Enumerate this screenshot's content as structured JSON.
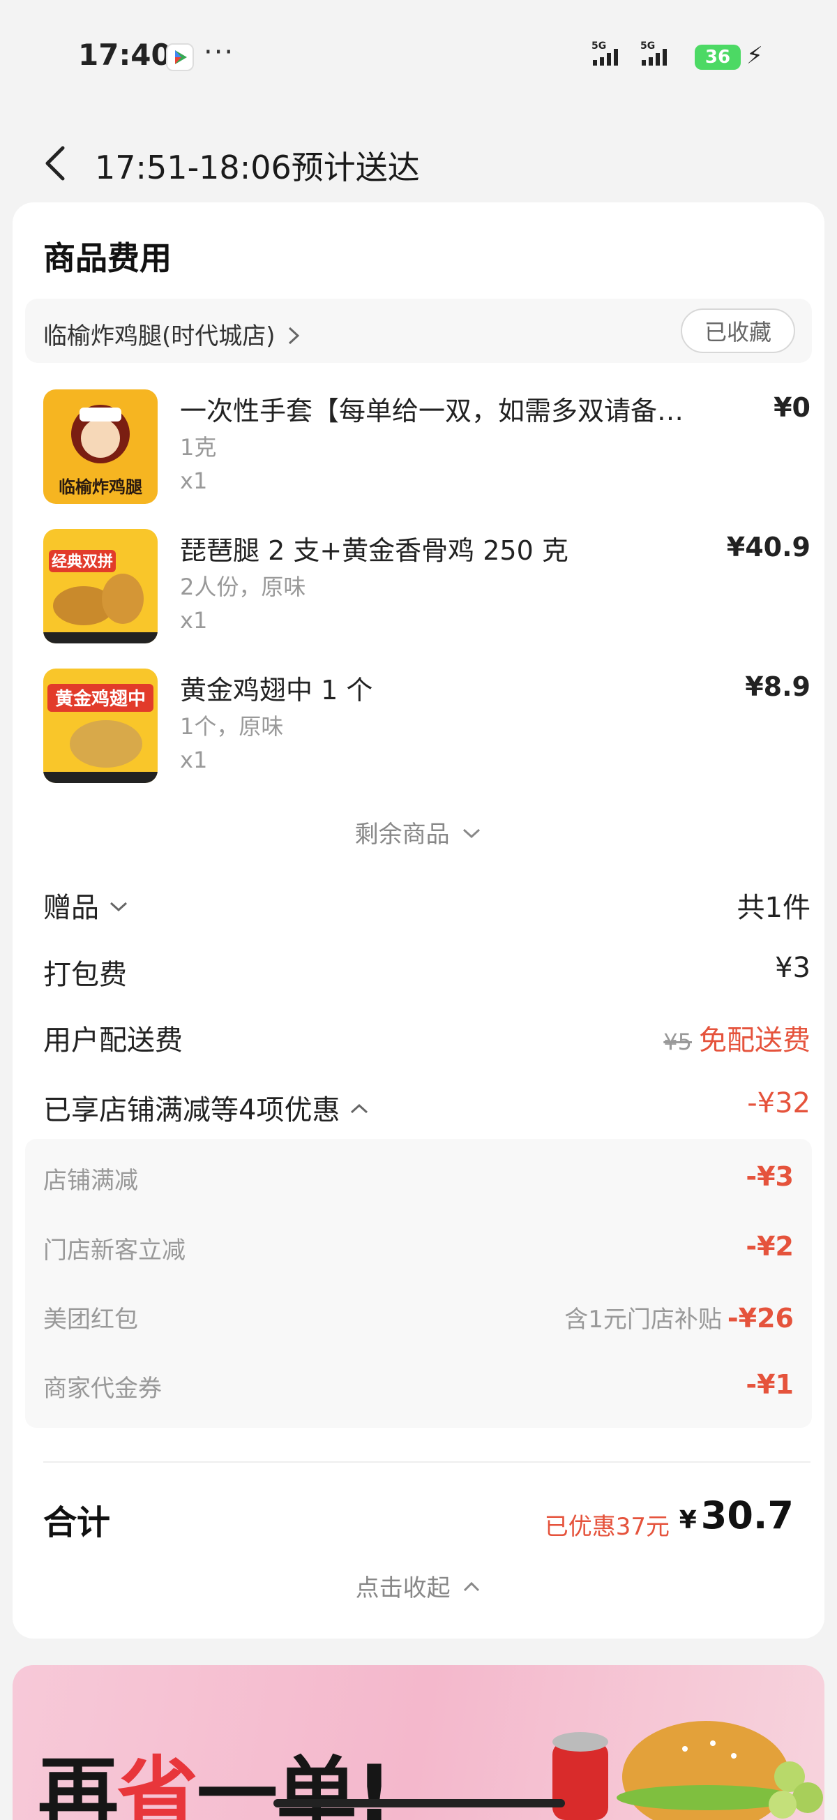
{
  "status": {
    "time": "17:40",
    "battery": "36",
    "dots": "···",
    "net1": "5G",
    "net2": "5G"
  },
  "header": {
    "title": "17:51-18:06预计送达"
  },
  "card": {
    "title": "商品费用",
    "store": {
      "name": "临榆炸鸡腿(时代城店)",
      "fav_label": "已收藏"
    },
    "items": [
      {
        "name": "一次性手套【每单给一双，如需多双请备…",
        "spec": "1克",
        "qty": "x1",
        "price": "¥0",
        "thumb_text": "临榆炸鸡腿"
      },
      {
        "name": "琵琶腿 2 支+黄金香骨鸡 250 克",
        "spec": "2人份，原味",
        "qty": "x1",
        "price": "¥40.9",
        "thumb_text": "经典双拼"
      },
      {
        "name": "黄金鸡翅中 1 个",
        "spec": "1个，原味",
        "qty": "x1",
        "price": "¥8.9",
        "thumb_text": "黄金鸡翅中"
      }
    ],
    "more_label": "剩余商品",
    "gift": {
      "label": "赠品",
      "value": "共1件"
    },
    "packing": {
      "label": "打包费",
      "value": "¥3"
    },
    "delivery": {
      "label": "用户配送费",
      "original": "¥5",
      "value": "免配送费"
    },
    "discount": {
      "label": "已享店铺满减等4项优惠",
      "value": "-¥32",
      "items": [
        {
          "label": "店铺满减",
          "note": "",
          "value": "-¥3"
        },
        {
          "label": "门店新客立减",
          "note": "",
          "value": "-¥2"
        },
        {
          "label": "美团红包",
          "note": "含1元门店补贴",
          "value": "-¥26"
        },
        {
          "label": "商家代金券",
          "note": "",
          "value": "-¥1"
        }
      ]
    },
    "total": {
      "label": "合计",
      "saved": "已优惠37元",
      "currency": "¥",
      "value": "30.7"
    },
    "collapse_label": "点击收起"
  },
  "promo": {
    "text_a": "再",
    "text_b": "省",
    "text_c": "一单!"
  }
}
